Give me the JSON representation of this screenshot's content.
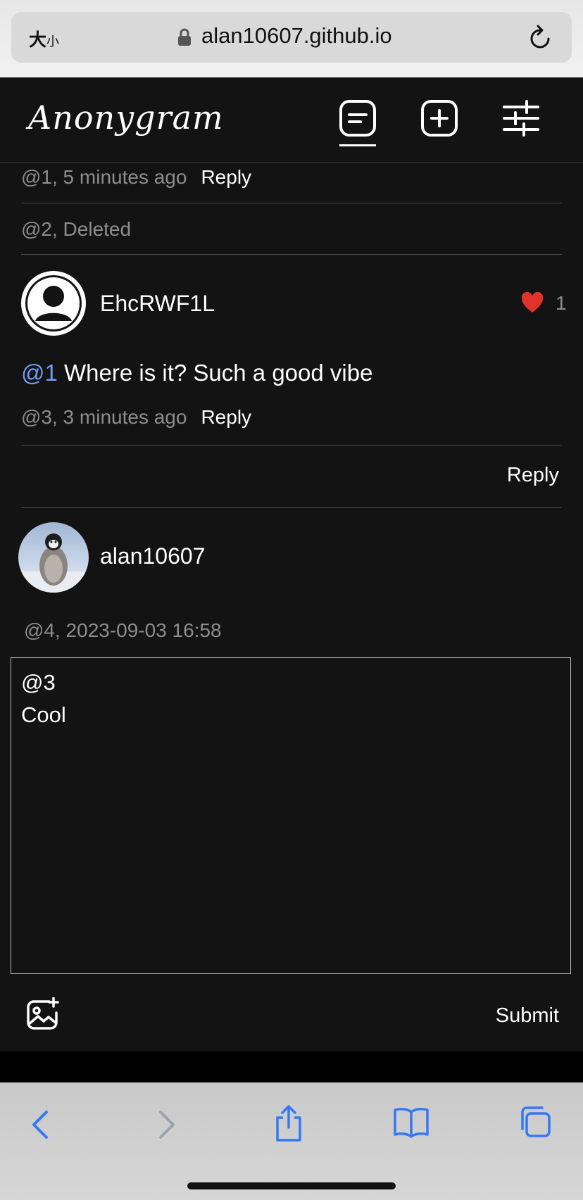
{
  "browser": {
    "text_size_label_big": "大",
    "text_size_label_small": "小",
    "domain": "alan10607.github.io"
  },
  "app": {
    "logo": "Anonygram"
  },
  "comments": [
    {
      "meta": "@1, 5 minutes ago",
      "reply": "Reply"
    },
    {
      "meta": "@2, Deleted"
    },
    {
      "username": "EhcRWF1L",
      "likes": "1",
      "mention": "@1",
      "text": "Where is it? Such a good vibe",
      "meta": "@3, 3 minutes ago",
      "reply": "Reply"
    }
  ],
  "thread_reply": "Reply",
  "composer": {
    "username": "alan10607",
    "meta": "@4, 2023-09-03 16:58",
    "text": "@3\nCool",
    "submit": "Submit"
  },
  "colors": {
    "background": "#131313",
    "mention": "#6d9cf4",
    "heart": "#e0342a",
    "safari_blue": "#3478f6"
  }
}
